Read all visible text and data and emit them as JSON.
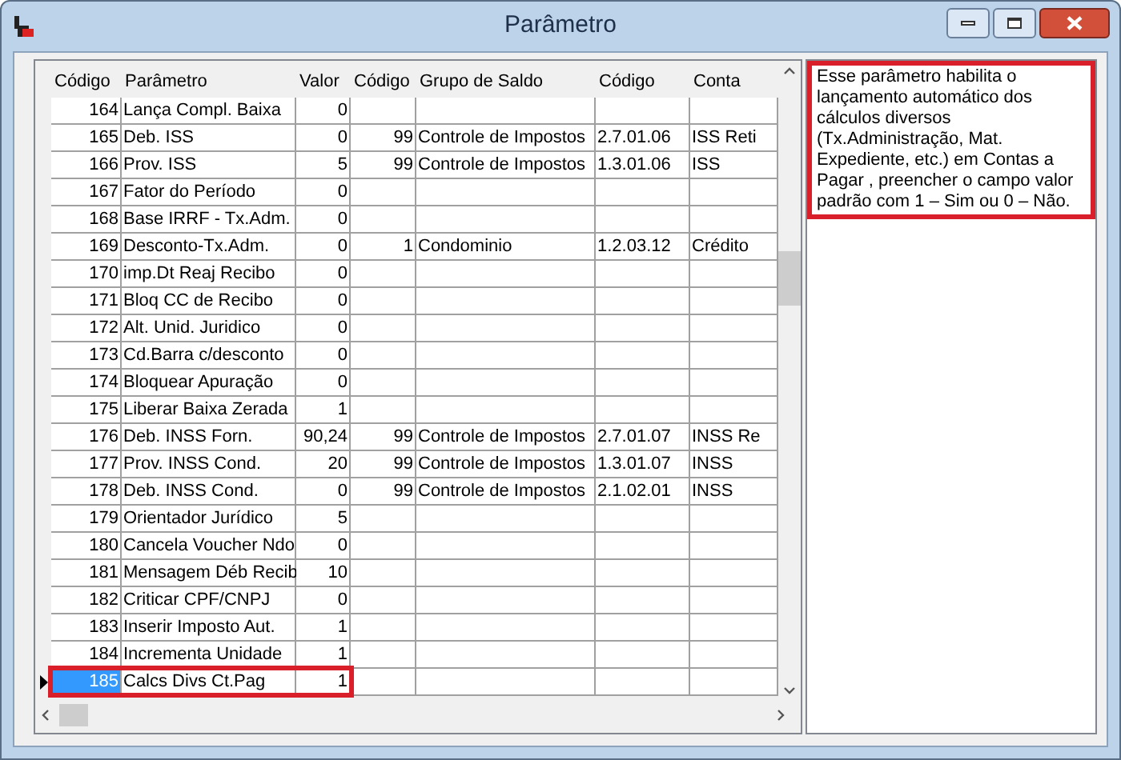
{
  "window": {
    "title": "Parâmetro"
  },
  "table": {
    "columns": [
      "Código",
      "Parâmetro",
      "Valor",
      "Código",
      "Grupo de Saldo",
      "Código",
      "Conta"
    ],
    "rows": [
      {
        "cells": [
          "164",
          "Lança Compl. Baixa",
          "0",
          "",
          "",
          "",
          ""
        ],
        "selected": false
      },
      {
        "cells": [
          "165",
          "Deb. ISS",
          "0",
          "99",
          "Controle de Impostos",
          "2.7.01.06",
          "ISS Reti"
        ],
        "selected": false
      },
      {
        "cells": [
          "166",
          "Prov. ISS",
          "5",
          "99",
          "Controle de Impostos",
          "1.3.01.06",
          "ISS"
        ],
        "selected": false
      },
      {
        "cells": [
          "167",
          "Fator do Período",
          "0",
          "",
          "",
          "",
          ""
        ],
        "selected": false
      },
      {
        "cells": [
          "168",
          "Base IRRF - Tx.Adm.",
          "0",
          "",
          "",
          "",
          ""
        ],
        "selected": false
      },
      {
        "cells": [
          "169",
          "Desconto-Tx.Adm.",
          "0",
          "1",
          "Condominio",
          "1.2.03.12",
          "Crédito"
        ],
        "selected": false
      },
      {
        "cells": [
          "170",
          "imp.Dt Reaj Recibo",
          "0",
          "",
          "",
          "",
          ""
        ],
        "selected": false
      },
      {
        "cells": [
          "171",
          "Bloq CC de Recibo",
          "0",
          "",
          "",
          "",
          ""
        ],
        "selected": false
      },
      {
        "cells": [
          "172",
          "Alt. Unid. Juridico",
          "0",
          "",
          "",
          "",
          ""
        ],
        "selected": false
      },
      {
        "cells": [
          "173",
          "Cd.Barra c/desconto",
          "0",
          "",
          "",
          "",
          ""
        ],
        "selected": false
      },
      {
        "cells": [
          "174",
          "Bloquear Apuração",
          "0",
          "",
          "",
          "",
          ""
        ],
        "selected": false
      },
      {
        "cells": [
          "175",
          "Liberar Baixa Zerada",
          "1",
          "",
          "",
          "",
          ""
        ],
        "selected": false
      },
      {
        "cells": [
          "176",
          "Deb. INSS Forn.",
          "90,24",
          "99",
          "Controle de Impostos",
          "2.7.01.07",
          "INSS Re"
        ],
        "selected": false
      },
      {
        "cells": [
          "177",
          "Prov. INSS Cond.",
          "20",
          "99",
          "Controle de Impostos",
          "1.3.01.07",
          "INSS"
        ],
        "selected": false
      },
      {
        "cells": [
          "178",
          "Deb. INSS Cond.",
          "0",
          "99",
          "Controle de Impostos",
          "2.1.02.01",
          "INSS"
        ],
        "selected": false
      },
      {
        "cells": [
          "179",
          "Orientador Jurídico",
          "5",
          "",
          "",
          "",
          ""
        ],
        "selected": false
      },
      {
        "cells": [
          "180",
          "Cancela Voucher Ndo",
          "0",
          "",
          "",
          "",
          ""
        ],
        "selected": false
      },
      {
        "cells": [
          "181",
          "Mensagem Déb Recib",
          "10",
          "",
          "",
          "",
          ""
        ],
        "selected": false
      },
      {
        "cells": [
          "182",
          "Criticar CPF/CNPJ",
          "0",
          "",
          "",
          "",
          ""
        ],
        "selected": false
      },
      {
        "cells": [
          "183",
          "Inserir Imposto Aut.",
          "1",
          "",
          "",
          "",
          ""
        ],
        "selected": false
      },
      {
        "cells": [
          "184",
          "Incrementa Unidade",
          "1",
          "",
          "",
          "",
          ""
        ],
        "selected": false
      },
      {
        "cells": [
          "185",
          "Calcs Divs Ct.Pag",
          "1",
          "",
          "",
          "",
          ""
        ],
        "selected": true
      }
    ]
  },
  "description": "Esse parâmetro habilita o lançamento automático dos cálculos diversos (Tx.Administração, Mat. Expediente, etc.) em Contas a Pagar , preencher o campo valor padrão com 1 – Sim ou 0 – Não."
}
